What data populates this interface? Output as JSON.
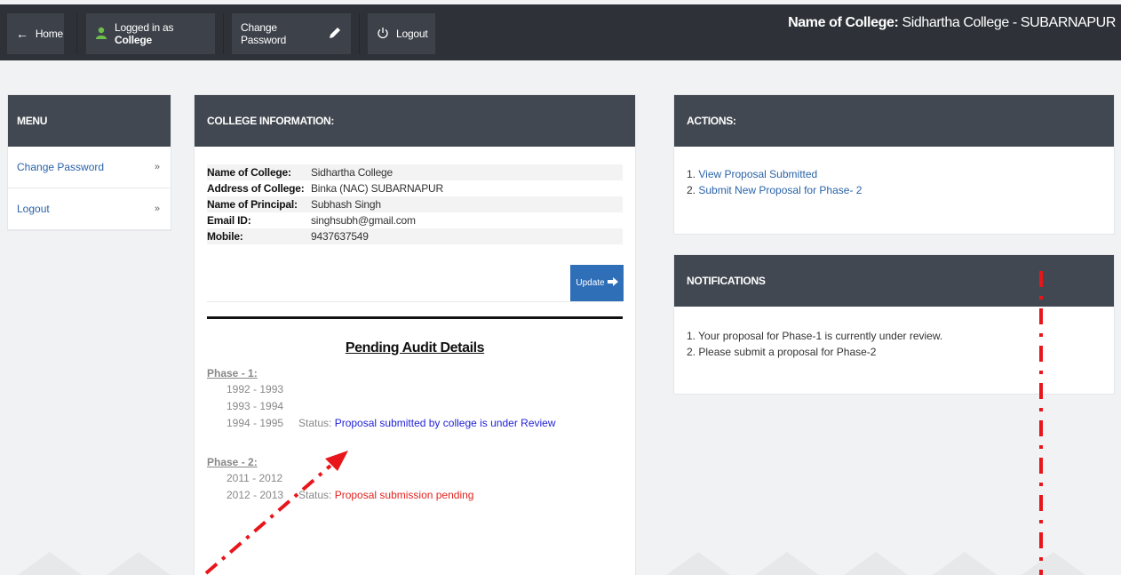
{
  "topbar": {
    "home_label": "Home",
    "logged_prefix": "Logged in as",
    "logged_role": "College",
    "change_password_label": "Change Password",
    "logout_label": "Logout",
    "college_name_prefix": "Name of College:",
    "college_name_value": "Sidhartha College - SUBARNAPUR"
  },
  "menu": {
    "title": "MENU",
    "items": [
      {
        "label": "Change Password",
        "chevron": "»"
      },
      {
        "label": "Logout",
        "chevron": "»"
      }
    ]
  },
  "college_info": {
    "title": "COLLEGE INFORMATION:",
    "rows": [
      {
        "key": "Name of College:",
        "value": "Sidhartha College"
      },
      {
        "key": "Address of College:",
        "value": "Binka (NAC) SUBARNAPUR"
      },
      {
        "key": "Name of Principal:",
        "value": "Subhash Singh"
      },
      {
        "key": "Email ID:",
        "value": "singhsubh@gmail.com"
      },
      {
        "key": "Mobile:",
        "value": "9437637549"
      }
    ],
    "update_label": "Update"
  },
  "pending_audit": {
    "title": "Pending Audit Details",
    "status_prefix": "Status:",
    "phases": [
      {
        "label": "Phase - 1:",
        "years": [
          "1992 - 1993",
          "1993 - 1994",
          "1994 - 1995"
        ],
        "status": "Proposal submitted by college is under Review",
        "status_color": "#2323d8"
      },
      {
        "label": "Phase - 2:",
        "years": [
          "2011 - 2012",
          "2012 - 2013"
        ],
        "status": "Proposal submission pending",
        "status_color": "#e2241f"
      }
    ]
  },
  "actions": {
    "title": "ACTIONS:",
    "items": [
      {
        "num": "1.",
        "label": "View Proposal Submitted"
      },
      {
        "num": "2.",
        "label": "Submit New Proposal for Phase- 2"
      }
    ]
  },
  "notifications": {
    "title": "NOTIFICATIONS",
    "items": [
      {
        "num": "1.",
        "text": "Your proposal for Phase-1 is currently under review."
      },
      {
        "num": "2.",
        "text": "Please submit a proposal for Phase-2"
      }
    ]
  },
  "colors": {
    "navbar_bg": "#2e3238",
    "panel_header_bg": "#424851",
    "link_blue": "#2a63a8",
    "button_blue": "#2f6fb8",
    "annotation_red": "#e8161b"
  },
  "icons": [
    "arrow-left-icon",
    "user-icon",
    "pencil-icon",
    "power-icon",
    "arrow-right-icon"
  ]
}
